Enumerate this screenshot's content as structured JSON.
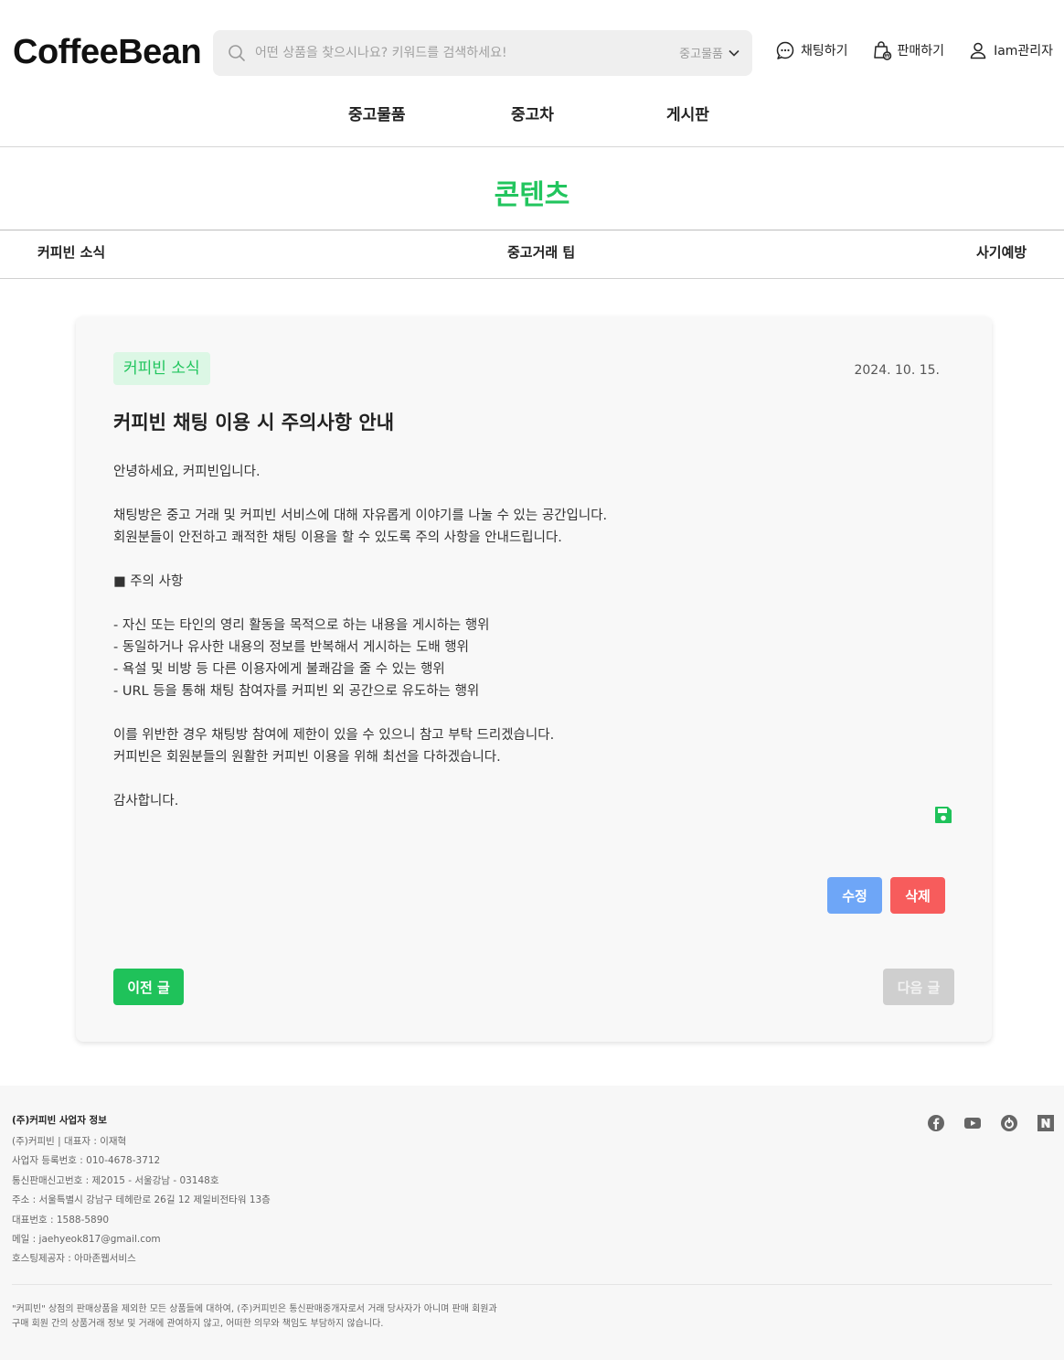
{
  "header": {
    "logo": "CoffeeBean",
    "search": {
      "placeholder": "어떤 상품을 찾으시나요? 키워드를 검색하세요!",
      "category": "중고물품"
    },
    "links": {
      "chat": "채팅하기",
      "sell": "판매하기",
      "user": "Iam관리자"
    }
  },
  "gnb": {
    "items": [
      "중고물품",
      "중고차",
      "게시판"
    ]
  },
  "section": {
    "title": "콘텐츠",
    "tabs": [
      "커피빈 소식",
      "중고거래 팁",
      "사기예방"
    ]
  },
  "post": {
    "category": "커피빈 소식",
    "date": "2024. 10. 15.",
    "title": "커피빈 채팅 이용 시 주의사항 안내",
    "body": [
      "안녕하세요, 커피빈입니다.",
      "",
      "채팅방은 중고 거래 및 커피빈 서비스에 대해 자유롭게 이야기를 나눌 수 있는 공간입니다.",
      "회원분들이 안전하고 쾌적한 채팅 이용을 할 수 있도록 주의 사항을 안내드립니다.",
      "",
      "■ 주의 사항",
      "",
      "- 자신 또는 타인의 영리 활동을 목적으로 하는 내용을 게시하는 행위",
      "- 동일하거나 유사한 내용의 정보를 반복해서 게시하는 도배 행위",
      "- 욕설 및 비방 등 다른 이용자에게 불쾌감을 줄 수 있는 행위",
      "- URL 등을 통해 채팅 참여자를 커피빈 외 공간으로 유도하는 행위",
      "",
      "이를 위반한 경우 채팅방 참여에 제한이 있을 수 있으니 참고 부탁 드리겠습니다.",
      "커피빈은 회원분들의 원활한 커피빈 이용을 위해 최선을 다하겠습니다.",
      "",
      "감사합니다."
    ],
    "edit_label": "수정",
    "delete_label": "삭제",
    "prev_label": "이전 글",
    "next_label": "다음 글"
  },
  "footer": {
    "heading": "(주)커피빈 사업자 정보",
    "lines": [
      "(주)커피빈 | 대표자 : 이재혁",
      "사업자 등록번호 : 010-4678-3712",
      "통신판매신고번호 : 제2015 - 서울강남 - 03148호",
      "주소 : 서울특별시 강남구 테헤란로 26길 12 제일비전타워 13층",
      "대표번호 : 1588-5890",
      "메일 : jaehyeok817@gmail.com",
      "호스팅제공자 : 아마존웹서비스"
    ],
    "disclaimer": [
      "\"커피빈\" 상점의 판매상품을 제외한 모든 상품들에 대하여, (주)커피빈은 통신판매중개자로서 거래 당사자가 아니며 판매 회원과",
      "구매 회원 간의 상품거래 정보 및 거래에 관여하지 않고, 어떠한 의무와 책임도 부담하지 않습니다."
    ],
    "social": [
      "facebook-icon",
      "youtube-icon",
      "blog-icon",
      "naver-icon"
    ]
  },
  "colors": {
    "accent": "#22c55e",
    "edit": "#6ea6f7",
    "delete": "#f75c5c",
    "disabled": "#cfcfcf"
  }
}
